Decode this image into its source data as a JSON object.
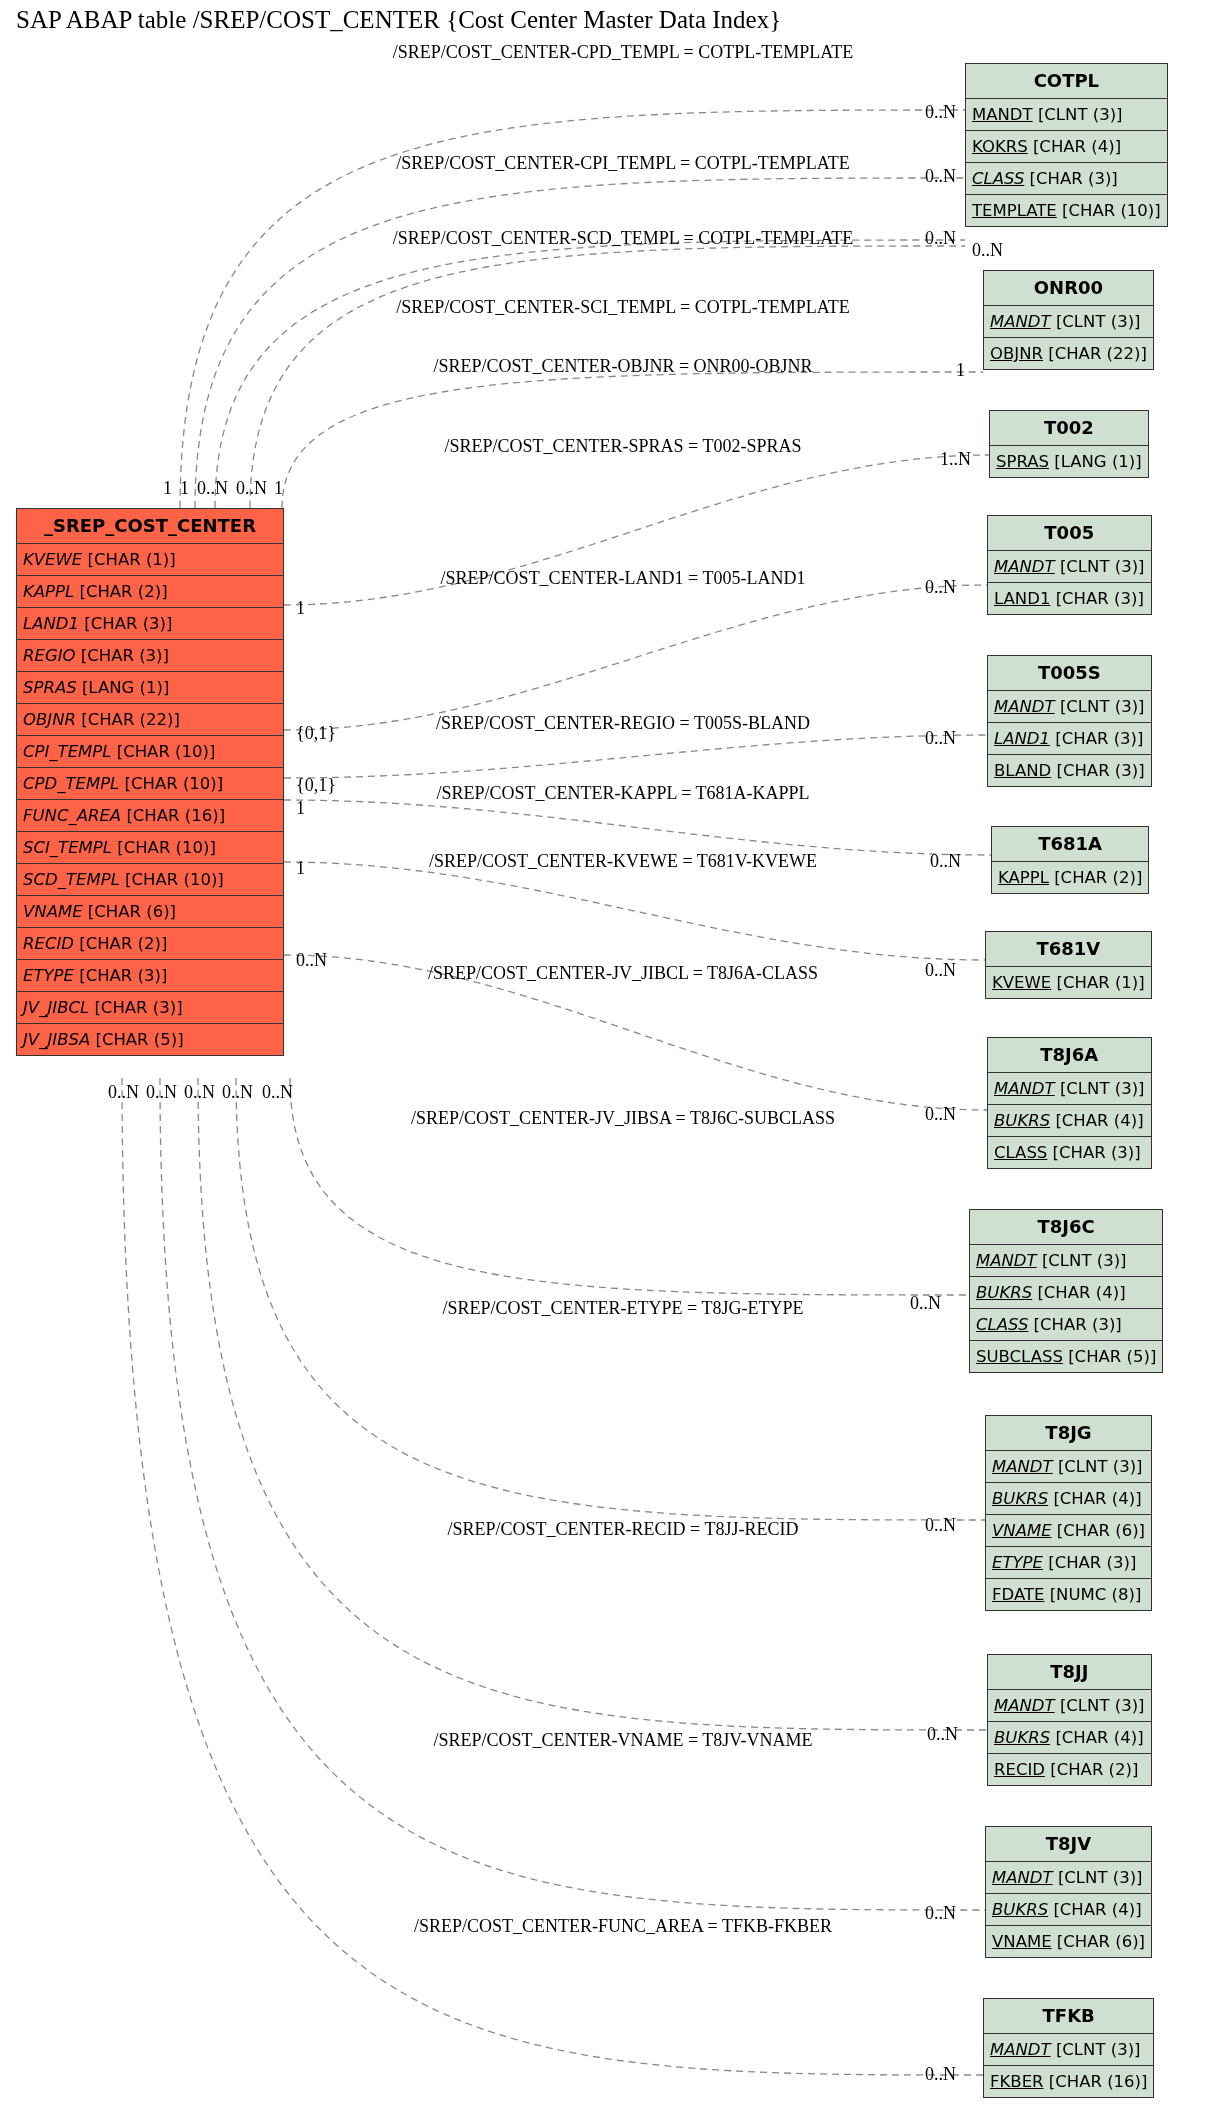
{
  "title": "SAP ABAP table /SREP/COST_CENTER {Cost Center Master Data Index}",
  "main_table": {
    "name": "_SREP_COST_CENTER",
    "fields": [
      {
        "name": "KVEWE",
        "type": "[CHAR (1)]",
        "key": false,
        "foreign": true
      },
      {
        "name": "KAPPL",
        "type": "[CHAR (2)]",
        "key": false,
        "foreign": true
      },
      {
        "name": "LAND1",
        "type": "[CHAR (3)]",
        "key": false,
        "foreign": true
      },
      {
        "name": "REGIO",
        "type": "[CHAR (3)]",
        "key": false,
        "foreign": true
      },
      {
        "name": "SPRAS",
        "type": "[LANG (1)]",
        "key": false,
        "foreign": true
      },
      {
        "name": "OBJNR",
        "type": "[CHAR (22)]",
        "key": false,
        "foreign": true
      },
      {
        "name": "CPI_TEMPL",
        "type": "[CHAR (10)]",
        "key": false,
        "foreign": true
      },
      {
        "name": "CPD_TEMPL",
        "type": "[CHAR (10)]",
        "key": false,
        "foreign": true
      },
      {
        "name": "FUNC_AREA",
        "type": "[CHAR (16)]",
        "key": false,
        "foreign": true
      },
      {
        "name": "SCI_TEMPL",
        "type": "[CHAR (10)]",
        "key": false,
        "foreign": true
      },
      {
        "name": "SCD_TEMPL",
        "type": "[CHAR (10)]",
        "key": false,
        "foreign": true
      },
      {
        "name": "VNAME",
        "type": "[CHAR (6)]",
        "key": false,
        "foreign": true
      },
      {
        "name": "RECID",
        "type": "[CHAR (2)]",
        "key": false,
        "foreign": true
      },
      {
        "name": "ETYPE",
        "type": "[CHAR (3)]",
        "key": false,
        "foreign": true
      },
      {
        "name": "JV_JIBCL",
        "type": "[CHAR (3)]",
        "key": false,
        "foreign": true
      },
      {
        "name": "JV_JIBSA",
        "type": "[CHAR (5)]",
        "key": false,
        "foreign": true
      }
    ]
  },
  "tables": [
    {
      "name": "COTPL",
      "fields": [
        {
          "name": "MANDT",
          "type": "[CLNT (3)]",
          "key": true,
          "foreign": false
        },
        {
          "name": "KOKRS",
          "type": "[CHAR (4)]",
          "key": true,
          "foreign": false
        },
        {
          "name": "CLASS",
          "type": "[CHAR (3)]",
          "key": true,
          "foreign": true
        },
        {
          "name": "TEMPLATE",
          "type": "[CHAR (10)]",
          "key": true,
          "foreign": false
        }
      ]
    },
    {
      "name": "ONR00",
      "fields": [
        {
          "name": "MANDT",
          "type": "[CLNT (3)]",
          "key": true,
          "foreign": true
        },
        {
          "name": "OBJNR",
          "type": "[CHAR (22)]",
          "key": true,
          "foreign": false
        }
      ]
    },
    {
      "name": "T002",
      "fields": [
        {
          "name": "SPRAS",
          "type": "[LANG (1)]",
          "key": true,
          "foreign": false
        }
      ]
    },
    {
      "name": "T005",
      "fields": [
        {
          "name": "MANDT",
          "type": "[CLNT (3)]",
          "key": true,
          "foreign": true
        },
        {
          "name": "LAND1",
          "type": "[CHAR (3)]",
          "key": true,
          "foreign": false
        }
      ]
    },
    {
      "name": "T005S",
      "fields": [
        {
          "name": "MANDT",
          "type": "[CLNT (3)]",
          "key": true,
          "foreign": true
        },
        {
          "name": "LAND1",
          "type": "[CHAR (3)]",
          "key": true,
          "foreign": true
        },
        {
          "name": "BLAND",
          "type": "[CHAR (3)]",
          "key": true,
          "foreign": false
        }
      ]
    },
    {
      "name": "T681A",
      "fields": [
        {
          "name": "KAPPL",
          "type": "[CHAR (2)]",
          "key": true,
          "foreign": false
        }
      ]
    },
    {
      "name": "T681V",
      "fields": [
        {
          "name": "KVEWE",
          "type": "[CHAR (1)]",
          "key": true,
          "foreign": false
        }
      ]
    },
    {
      "name": "T8J6A",
      "fields": [
        {
          "name": "MANDT",
          "type": "[CLNT (3)]",
          "key": true,
          "foreign": true
        },
        {
          "name": "BUKRS",
          "type": "[CHAR (4)]",
          "key": true,
          "foreign": true
        },
        {
          "name": "CLASS",
          "type": "[CHAR (3)]",
          "key": true,
          "foreign": false
        }
      ]
    },
    {
      "name": "T8J6C",
      "fields": [
        {
          "name": "MANDT",
          "type": "[CLNT (3)]",
          "key": true,
          "foreign": true
        },
        {
          "name": "BUKRS",
          "type": "[CHAR (4)]",
          "key": true,
          "foreign": true
        },
        {
          "name": "CLASS",
          "type": "[CHAR (3)]",
          "key": true,
          "foreign": true
        },
        {
          "name": "SUBCLASS",
          "type": "[CHAR (5)]",
          "key": true,
          "foreign": false
        }
      ]
    },
    {
      "name": "T8JG",
      "fields": [
        {
          "name": "MANDT",
          "type": "[CLNT (3)]",
          "key": true,
          "foreign": true
        },
        {
          "name": "BUKRS",
          "type": "[CHAR (4)]",
          "key": true,
          "foreign": true
        },
        {
          "name": "VNAME",
          "type": "[CHAR (6)]",
          "key": true,
          "foreign": true
        },
        {
          "name": "ETYPE",
          "type": "[CHAR (3)]",
          "key": true,
          "foreign": true
        },
        {
          "name": "FDATE",
          "type": "[NUMC (8)]",
          "key": true,
          "foreign": false
        }
      ]
    },
    {
      "name": "T8JJ",
      "fields": [
        {
          "name": "MANDT",
          "type": "[CLNT (3)]",
          "key": true,
          "foreign": true
        },
        {
          "name": "BUKRS",
          "type": "[CHAR (4)]",
          "key": true,
          "foreign": true
        },
        {
          "name": "RECID",
          "type": "[CHAR (2)]",
          "key": true,
          "foreign": false
        }
      ]
    },
    {
      "name": "T8JV",
      "fields": [
        {
          "name": "MANDT",
          "type": "[CLNT (3)]",
          "key": true,
          "foreign": true
        },
        {
          "name": "BUKRS",
          "type": "[CHAR (4)]",
          "key": true,
          "foreign": true
        },
        {
          "name": "VNAME",
          "type": "[CHAR (6)]",
          "key": true,
          "foreign": false
        }
      ]
    },
    {
      "name": "TFKB",
      "fields": [
        {
          "name": "MANDT",
          "type": "[CLNT (3)]",
          "key": true,
          "foreign": true
        },
        {
          "name": "FKBER",
          "type": "[CHAR (16)]",
          "key": true,
          "foreign": false
        }
      ]
    }
  ],
  "relations": [
    {
      "label": "/SREP/COST_CENTER-CPD_TEMPL = COTPL-TEMPLATE",
      "source_card": "1",
      "target_card": "0..N"
    },
    {
      "label": "/SREP/COST_CENTER-CPI_TEMPL = COTPL-TEMPLATE",
      "source_card": "1",
      "target_card": "0..N"
    },
    {
      "label": "/SREP/COST_CENTER-SCD_TEMPL = COTPL-TEMPLATE",
      "source_card": "0..N",
      "target_card": "0..N"
    },
    {
      "label": "/SREP/COST_CENTER-SCI_TEMPL = COTPL-TEMPLATE",
      "source_card": "0..N",
      "target_card": "0..N"
    },
    {
      "label": "/SREP/COST_CENTER-OBJNR = ONR00-OBJNR",
      "source_card": "1",
      "target_card": "1"
    },
    {
      "label": "/SREP/COST_CENTER-SPRAS = T002-SPRAS",
      "source_card": "1",
      "target_card": "1..N"
    },
    {
      "label": "/SREP/COST_CENTER-LAND1 = T005-LAND1",
      "source_card": "{0,1}",
      "target_card": "0..N"
    },
    {
      "label": "/SREP/COST_CENTER-REGIO = T005S-BLAND",
      "source_card": "{0,1}",
      "target_card": "0..N"
    },
    {
      "label": "/SREP/COST_CENTER-KAPPL = T681A-KAPPL",
      "source_card": "1",
      "target_card": "0..N"
    },
    {
      "label": "/SREP/COST_CENTER-KVEWE = T681V-KVEWE",
      "source_card": "1",
      "target_card": "0..N"
    },
    {
      "label": "/SREP/COST_CENTER-JV_JIBCL = T8J6A-CLASS",
      "source_card": "0..N",
      "target_card": "0..N"
    },
    {
      "label": "/SREP/COST_CENTER-JV_JIBSA = T8J6C-SUBCLASS",
      "source_card": "0..N",
      "target_card": "0..N"
    },
    {
      "label": "/SREP/COST_CENTER-ETYPE = T8JG-ETYPE",
      "source_card": "0..N",
      "target_card": "0..N"
    },
    {
      "label": "/SREP/COST_CENTER-RECID = T8JJ-RECID",
      "source_card": "0..N",
      "target_card": "0..N"
    },
    {
      "label": "/SREP/COST_CENTER-VNAME = T8JV-VNAME",
      "source_card": "0..N",
      "target_card": "0..N"
    },
    {
      "label": "/SREP/COST_CENTER-FUNC_AREA = TFKB-FKBER",
      "source_card": "0..N",
      "target_card": "0..N"
    }
  ]
}
